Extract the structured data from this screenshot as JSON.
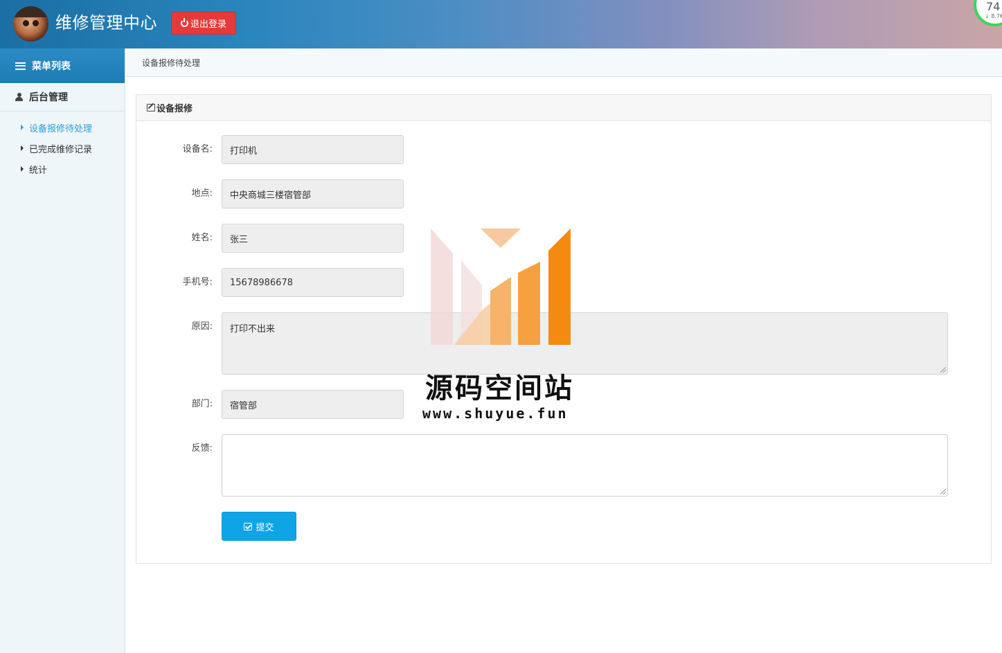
{
  "header": {
    "app_title": "维修管理中心",
    "logout_label": "退出登录",
    "net_widget": {
      "value": "74",
      "speed": "8.7K"
    }
  },
  "sidebar": {
    "menu_title": "菜单列表",
    "group_title": "后台管理",
    "items": [
      {
        "label": "设备报修待处理",
        "active": true
      },
      {
        "label": "已完成维修记录",
        "active": false
      },
      {
        "label": "统计",
        "active": false
      }
    ]
  },
  "breadcrumb": "设备报修待处理",
  "panel": {
    "title": "设备报修",
    "fields": {
      "device_name": {
        "label": "设备名:",
        "value": "打印机"
      },
      "location": {
        "label": "地点:",
        "value": "中央商城三楼宿管部"
      },
      "name": {
        "label": "姓名:",
        "value": "张三"
      },
      "phone": {
        "label": "手机号:",
        "value": "15678986678"
      },
      "reason": {
        "label": "原因:",
        "value": "打印不出来"
      },
      "department": {
        "label": "部门:",
        "value": "宿管部"
      },
      "feedback": {
        "label": "反馈:",
        "value": ""
      }
    },
    "submit_label": "提交"
  },
  "watermark": {
    "title": "源码空间站",
    "url": "www.shuyue.fun"
  },
  "colors": {
    "header_start": "#1a6fa4",
    "logout": "#e43a3a",
    "active_nav": "#2a9fd6",
    "submit": "#0fa4e6"
  }
}
